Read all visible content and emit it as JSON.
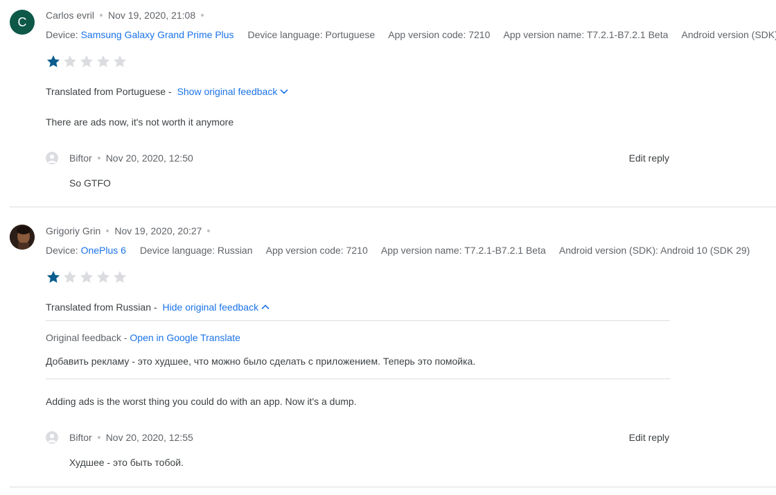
{
  "reviews": [
    {
      "avatar_letter": "C",
      "author": "Carlos evril",
      "date": "Nov 19, 2020, 21:08",
      "device_label": "Device:",
      "device": "Samsung Galaxy Grand Prime Plus",
      "language": "Device language: Portuguese",
      "app_code": "App version code: 7210",
      "app_name": "App version name: T7.2.1-B7.2.1 Beta",
      "android": "Android version (SDK)",
      "rating": 1,
      "translated_from": "Translated from Portuguese -",
      "toggle_label": "Show original feedback",
      "text": "There are ads now, it's not worth it anymore",
      "reply": {
        "author": "Biftor",
        "date": "Nov 20, 2020, 12:50",
        "edit_label": "Edit reply",
        "text": "So GTFO"
      }
    },
    {
      "author": "Grigoriy Grin",
      "date": "Nov 19, 2020, 20:27",
      "device_label": "Device:",
      "device": "OnePlus 6",
      "language": "Device language: Russian",
      "app_code": "App version code: 7210",
      "app_name": "App version name: T7.2.1-B7.2.1 Beta",
      "android": "Android version (SDK): Android 10 (SDK 29)",
      "rating": 1,
      "translated_from": "Translated from Russian -",
      "toggle_label": "Hide original feedback",
      "original_label": "Original feedback -",
      "translate_link": "Open in Google Translate",
      "original_text": "Добавить рекламу - это худшее, что можно было сделать с приложением. Теперь это помойка.",
      "text": "Adding ads is the worst thing you could do with an app. Now it's a dump.",
      "reply": {
        "author": "Biftor",
        "date": "Nov 20, 2020, 12:55",
        "edit_label": "Edit reply",
        "text": "Худшее - это быть тобой."
      }
    }
  ],
  "colors": {
    "star_filled": "#0b5d8e",
    "star_empty": "#dadce0",
    "link": "#1a73e8",
    "avatar_bg": "#0e5848"
  },
  "icons": {
    "star": "star-icon",
    "chevron_down": "chevron-down-icon",
    "chevron_up": "chevron-up-icon"
  }
}
